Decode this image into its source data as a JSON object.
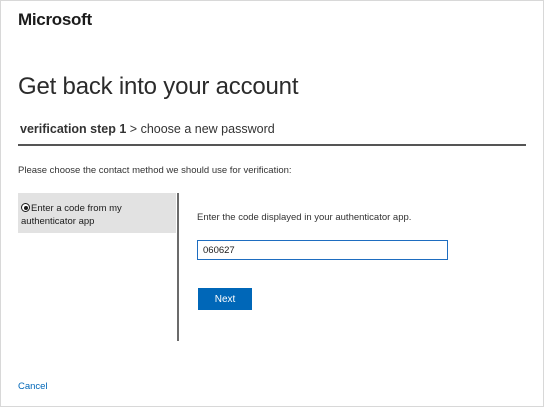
{
  "brand": {
    "logo_text": "Microsoft"
  },
  "page": {
    "title": "Get back into your account"
  },
  "steps": {
    "current": "verification step 1",
    "separator": ">",
    "next": "choose a new password"
  },
  "instructions": "Please choose the contact method we should use for verification:",
  "methods": [
    {
      "label": "Enter a code from my authenticator app",
      "selected": true
    }
  ],
  "code": {
    "prompt": "Enter the code displayed in your authenticator app.",
    "value": "060627"
  },
  "buttons": {
    "next_label": "Next",
    "cancel_label": "Cancel"
  },
  "colors": {
    "accent": "#0067b8",
    "selected_method_bg": "#e2e2e2",
    "input_border": "#1e6dc0"
  }
}
